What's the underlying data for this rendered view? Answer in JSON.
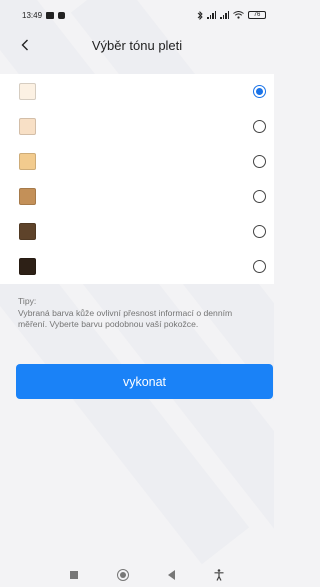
{
  "status_bar": {
    "time": "13:49",
    "battery": "76"
  },
  "header": {
    "title": "Výběr tónu pleti"
  },
  "skin_tones": [
    {
      "color": "#FCF1E3",
      "selected": true
    },
    {
      "color": "#F8E0C6",
      "selected": false
    },
    {
      "color": "#F2CB8E",
      "selected": false
    },
    {
      "color": "#C39058",
      "selected": false
    },
    {
      "color": "#5E432A",
      "selected": false
    },
    {
      "color": "#2D2016",
      "selected": false
    }
  ],
  "tips": {
    "label": "Tipy:",
    "text": "Vybraná barva kůže ovlivní přesnost informací o denním měření. Vyberte barvu podobnou vaší pokožce."
  },
  "action": {
    "label": "vykonat"
  },
  "colors": {
    "accent": "#1A82F7",
    "radio_selected": "#1A73E8"
  }
}
